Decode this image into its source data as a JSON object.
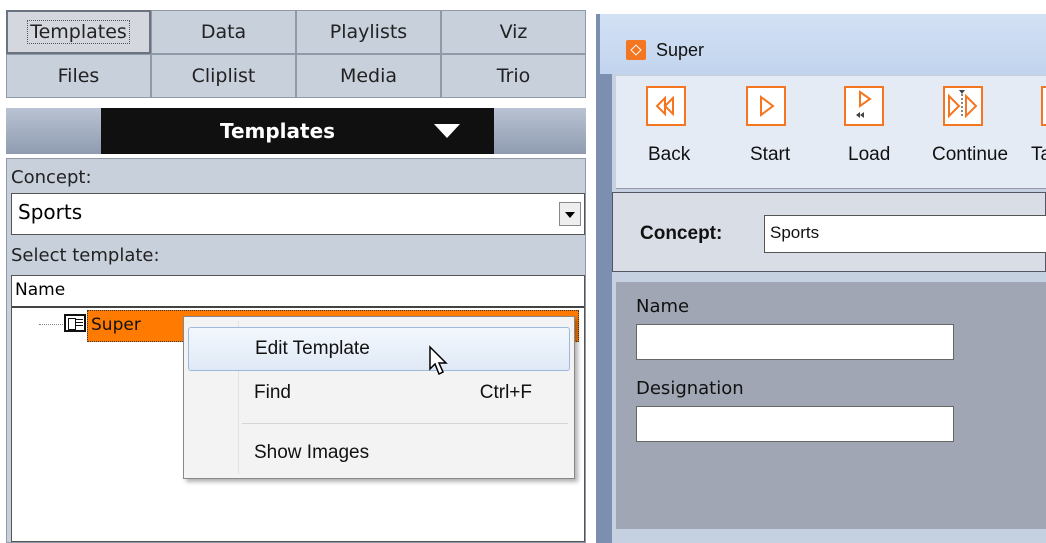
{
  "left_panel": {
    "tabs": [
      "Templates",
      "Data",
      "Playlists",
      "Viz",
      "Files",
      "Cliplist",
      "Media",
      "Trio"
    ],
    "selected_tab": "Templates",
    "title": "Templates",
    "concept_label": "Concept:",
    "concept_value": "Sports",
    "select_template_label": "Select template:",
    "tree": {
      "column_header": "Name",
      "items": [
        {
          "label": "Super",
          "selected": true
        }
      ]
    }
  },
  "context_menu": {
    "items": [
      {
        "label": "Edit Template",
        "shortcut": "",
        "highlighted": true
      },
      {
        "label": "Find",
        "shortcut": "Ctrl+F",
        "highlighted": false
      },
      {
        "label": "Show Images",
        "shortcut": "",
        "highlighted": false
      }
    ]
  },
  "right_window": {
    "title": "Super",
    "toolbar": [
      {
        "label": "Back",
        "icon": "back-icon"
      },
      {
        "label": "Start",
        "icon": "start-icon"
      },
      {
        "label": "Load",
        "icon": "load-icon"
      },
      {
        "label": "Continue",
        "icon": "continue-icon"
      },
      {
        "label": "Ta",
        "icon": "take-icon"
      }
    ],
    "concept_label": "Concept:",
    "concept_value": "Sports",
    "fields": [
      {
        "label": "Name",
        "value": ""
      },
      {
        "label": "Designation",
        "value": ""
      }
    ]
  },
  "colors": {
    "accent": "#f47620",
    "selection": "#ff7a00",
    "panel": "#c8d0dc"
  }
}
